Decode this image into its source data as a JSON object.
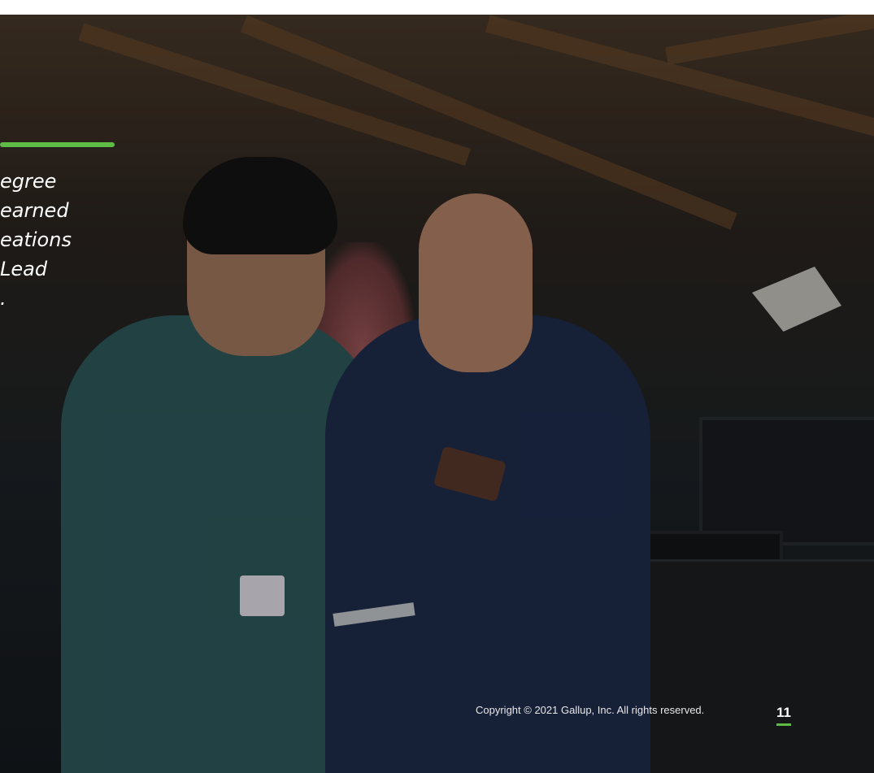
{
  "slide": {
    "quote_lines": [
      "egree",
      " earned",
      "eations",
      "Lead",
      "."
    ],
    "copyright": "Copyright © 2021 Gallup, Inc. All rights reserved.",
    "page_number": "11"
  },
  "colors": {
    "accent": "#5dbb46",
    "text": "#ffffff"
  }
}
